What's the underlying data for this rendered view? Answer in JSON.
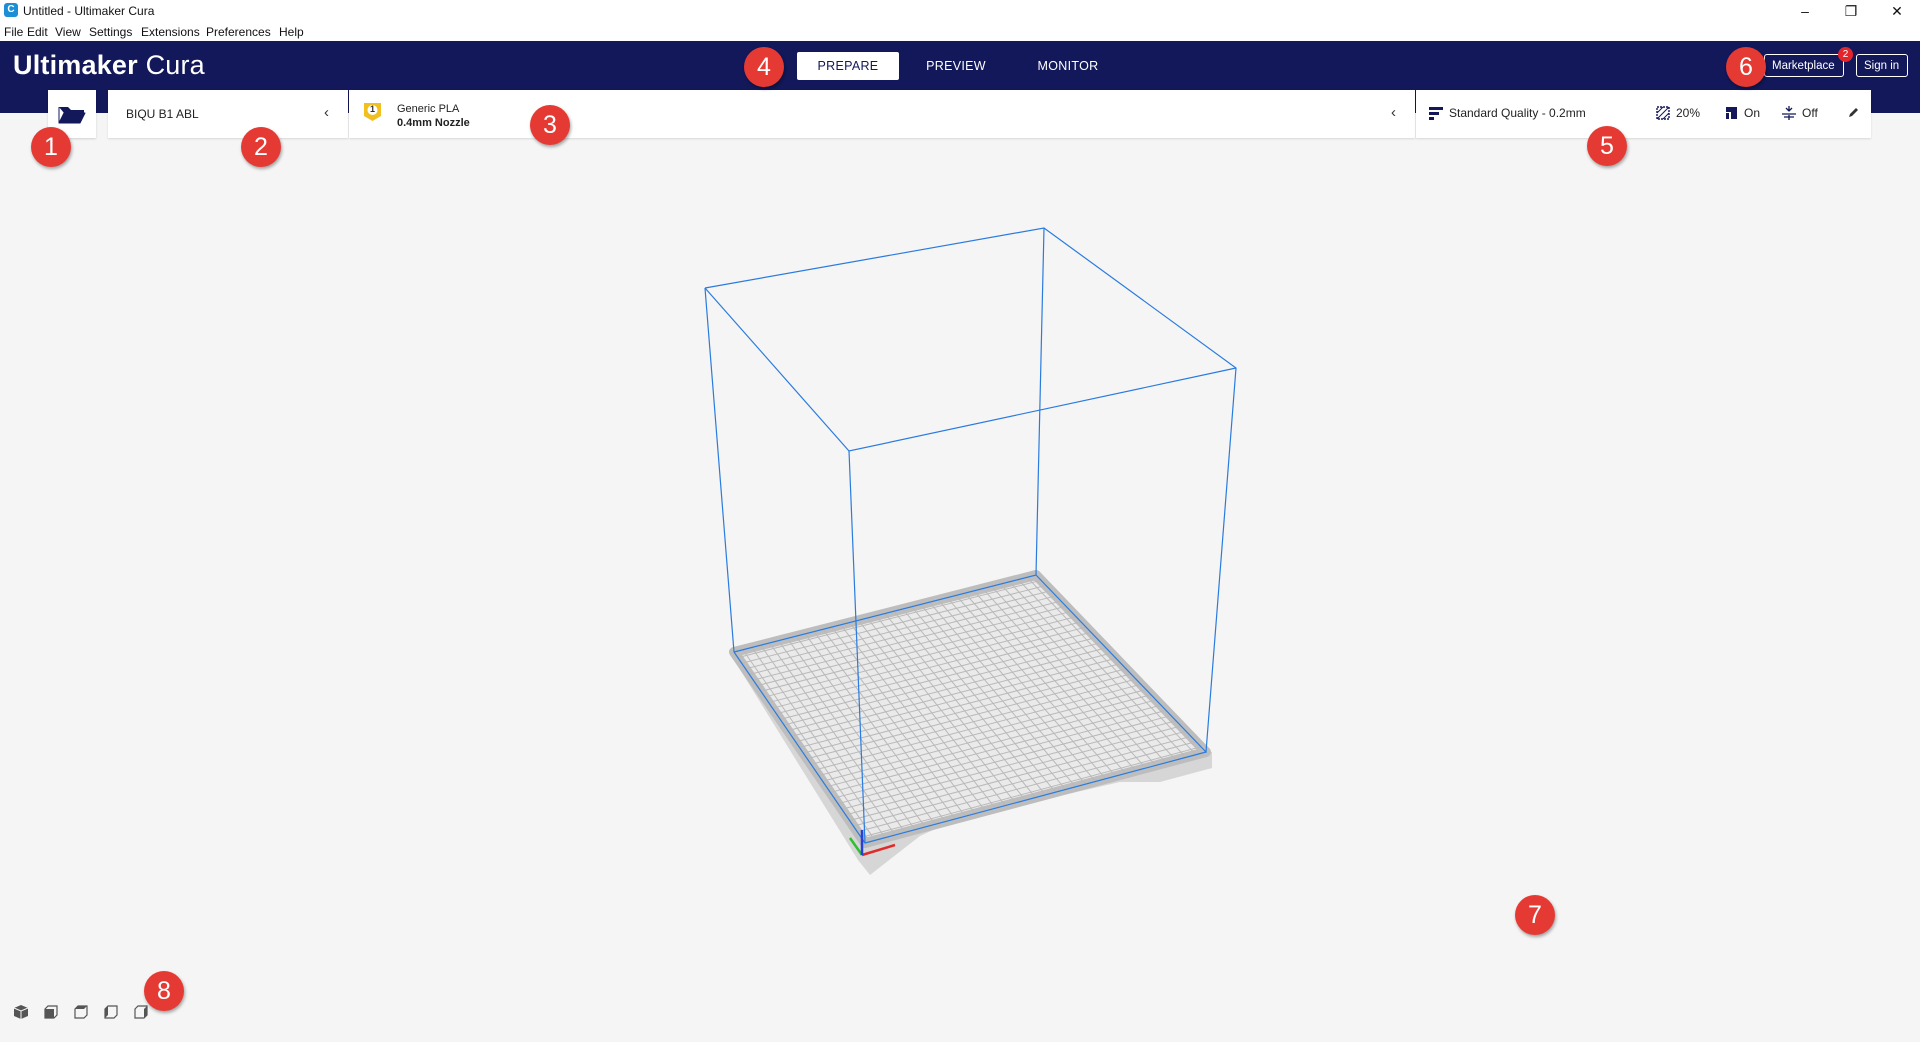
{
  "window": {
    "title": "Untitled - Ultimaker Cura",
    "app_icon_glyph": "C"
  },
  "menu": [
    "File",
    "Edit",
    "View",
    "Settings",
    "Extensions",
    "Preferences",
    "Help"
  ],
  "header": {
    "logo_bold": "Ultimaker",
    "logo_thin": "Cura",
    "tabs": [
      {
        "label": "PREPARE",
        "active": true
      },
      {
        "label": "PREVIEW",
        "active": false
      },
      {
        "label": "MONITOR",
        "active": false
      }
    ],
    "marketplace_label": "Marketplace",
    "marketplace_badge": "2",
    "signin_label": "Sign in"
  },
  "printer": {
    "name": "BIQU B1 ABL"
  },
  "material": {
    "extruder_number": "1",
    "name": "Generic PLA",
    "nozzle": "0.4mm Nozzle",
    "badge_color": "#f2c01e"
  },
  "print_settings": {
    "profile": "Standard Quality - 0.2mm",
    "infill": "20%",
    "support": "On",
    "adhesion": "Off"
  },
  "icons": {
    "open_file": "folder-open-icon",
    "chevron": "chevron-left-icon",
    "profile": "quality-profile-icon",
    "infill": "infill-icon",
    "support": "support-icon",
    "adhesion": "adhesion-icon",
    "edit": "pencil-icon"
  },
  "colors": {
    "header_bg": "#12185a",
    "build_volume_edge": "#2a7bde",
    "marker": "#e53a33"
  },
  "annotations": [
    "1",
    "2",
    "3",
    "4",
    "5",
    "6",
    "7",
    "8"
  ]
}
